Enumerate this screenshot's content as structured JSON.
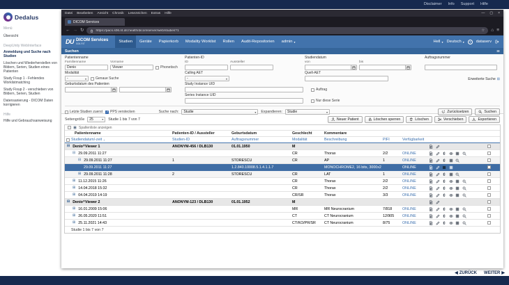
{
  "outer": {
    "top_links": [
      "Disclaimer",
      "Info",
      "Support",
      "Hilfe"
    ],
    "back_label": "ZURÜCK",
    "next_label": "WEITER"
  },
  "sidebar": {
    "brand": "Dedalus",
    "menu_label": "Menü",
    "items": [
      {
        "label": "Übersicht",
        "type": "item"
      },
      {
        "label": "DeepUnity WebInterface",
        "type": "section"
      },
      {
        "label": "Anmeldung und Suche nach Studien",
        "type": "item",
        "active": true
      },
      {
        "label": "Löschen und Wiederherstellen von Bildern, Serien, Studien eines Patienten",
        "type": "item"
      },
      {
        "label": "Study Fixup 1 - Fehlendes Worklistmatching",
        "type": "item"
      },
      {
        "label": "Study Fixup 2 - verschieben von Bildern, Serien, Studien",
        "type": "item"
      },
      {
        "label": "Datensanierung - DICOM Daten korrigieren",
        "type": "item"
      },
      {
        "label": "Hilfe",
        "type": "section"
      },
      {
        "label": "Hilfe und Gebrauchsanweisung",
        "type": "item"
      }
    ]
  },
  "browser": {
    "menubar": [
      "Datei",
      "Bearbeiten",
      "Ansicht",
      "Chronik",
      "Lesezeichen",
      "Extras",
      "Hilfe"
    ],
    "window_controls": [
      "—",
      "▢",
      "×"
    ],
    "tab_title": "DICOM Services",
    "url": "https://pacs.s06.rit.dit.health/dicomserver/web/studies?1"
  },
  "app": {
    "logo_text": "DU",
    "title": "DICOM Services",
    "subtitle": "S06.RIT",
    "nav": [
      {
        "label": "Studien",
        "active": true
      },
      {
        "label": "Geräte"
      },
      {
        "label": "Papierkorb"
      },
      {
        "label": "Modality Worklist"
      },
      {
        "label": "Rollen"
      },
      {
        "label": "Audit-Repositorien"
      },
      {
        "label": "admin",
        "caret": true
      }
    ],
    "theme_label": "Hell",
    "language_label": "Deutsch",
    "user_label": "dataserv"
  },
  "search": {
    "section_title": "Suchen",
    "patient_name_label": "Patientenname",
    "family_label": "Familienname",
    "family_value": "Denio",
    "given_label": "Vorname",
    "given_value": "Viewer",
    "phonetic_label": "Phonetisch",
    "patient_id_label": "Patienten-ID",
    "id_label": "ID",
    "issuer_label": "Aussteller",
    "study_date_label": "Studiendatum",
    "from_label": "von",
    "to_label": "bis",
    "accession_label": "Auftragsnummer",
    "modality_label": "Modalität",
    "modality_value": "-",
    "exact_search_label": "Genaue Suche",
    "calling_aet_label": "Calling AET",
    "calling_aet_value": "-",
    "source_aet_label": "Quell-AET",
    "advanced_link": "Erweiterte Suche",
    "birth_date_label": "Geburtsdatum des Patienten",
    "study_uid_label": "Study Instance UID",
    "series_uid_label": "Series Instance UID",
    "order_label": "Auftrag",
    "only_series_label": "Nur diese Serie",
    "latest_first_label": "Letzte Studien zuerst",
    "pps_hide_label": "PPS verstecken",
    "search_by_label": "Suche nach:",
    "search_by_value": "Studie",
    "expand_label": "Expandieren:",
    "expand_value": "Studie",
    "reset_label": "Zurücksetzen",
    "search_label": "Suchen"
  },
  "results": {
    "page_size_label": "Seitengröße",
    "page_size_value": "25",
    "range_text": "Studie 1 bis 7 von 7",
    "footer_text": "Studie 1 bis 7 von 7",
    "column_toggle_label": "Spaltenliste anzeigen",
    "actions": [
      {
        "label": "Neuer Patient",
        "icon": "person"
      },
      {
        "label": "Löschen sperren",
        "icon": "lock"
      },
      {
        "label": "Löschen",
        "icon": "trash"
      },
      {
        "label": "Verschieben",
        "icon": "scissors"
      },
      {
        "label": "Exportieren",
        "icon": "export"
      }
    ],
    "header_row1": [
      "Patientenname",
      "Patienten-ID / Aussteller",
      "Geburtsdatum",
      "Geschlecht",
      "Kommentare",
      "",
      "",
      "",
      ""
    ],
    "header_row2": [
      "Studiendatum/-zeit",
      "Studien-ID",
      "Auftragsnummer",
      "Modalität",
      "Beschreibung",
      "PIFI",
      "Verfügbarkeit",
      "",
      ""
    ],
    "rows": [
      {
        "type": "patient",
        "level": 0,
        "exp": "open",
        "c": [
          "Denio^Viewer 1",
          "ANONYM-456 / DLB130",
          "01.01.1950",
          "M",
          "",
          "",
          ""
        ],
        "icons": [
          "doc",
          "edit"
        ]
      },
      {
        "type": "study",
        "level": 1,
        "exp": "open",
        "c": [
          "29.09.2011 11:27",
          "",
          "",
          "CR",
          "Thorax",
          "2/2",
          "ONLINE"
        ],
        "icons": [
          "doc",
          "edit",
          "clip",
          "eye",
          "grid",
          "search"
        ]
      },
      {
        "type": "series",
        "level": 2,
        "exp": "open",
        "c": [
          "29.09.2011 11:27",
          "1",
          "STORESCU",
          "CR",
          "AP",
          "1",
          "ONLINE"
        ],
        "icons": [
          "doc",
          "edit",
          "clip",
          "grid",
          "search"
        ]
      },
      {
        "type": "instance",
        "level": 3,
        "exp": "none",
        "selected": true,
        "c": [
          "29.09.2011 11:27",
          "",
          "1.2.840.10008.5.1.4.1.1.7",
          "",
          "MONOCHROME2, 16 bits, 3000x2342",
          "",
          "ONLINE"
        ],
        "icons": [
          "doc",
          "edit",
          "boxdark",
          "grid"
        ]
      },
      {
        "type": "series",
        "level": 2,
        "exp": "closed",
        "c": [
          "29.09.2011 11:28",
          "2",
          "STORESCU",
          "CR",
          "LAT",
          "1",
          "ONLINE"
        ],
        "icons": [
          "doc",
          "edit",
          "clip",
          "grid",
          "search"
        ]
      },
      {
        "type": "study",
        "level": 1,
        "exp": "closed",
        "c": [
          "11.12.2015 11:26",
          "",
          "",
          "CR",
          "Thorax",
          "2/2",
          "ONLINE"
        ],
        "icons": [
          "doc",
          "edit",
          "clip",
          "eye",
          "grid",
          "search"
        ]
      },
      {
        "type": "study",
        "level": 1,
        "exp": "closed",
        "c": [
          "14.04.2018 15:32",
          "",
          "",
          "CR",
          "Thorax",
          "2/2",
          "ONLINE"
        ],
        "icons": [
          "doc",
          "edit",
          "clip",
          "eye",
          "grid",
          "search"
        ]
      },
      {
        "type": "study",
        "level": 1,
        "exp": "closed",
        "c": [
          "04.04.2019 14:19",
          "",
          "",
          "CR/SR",
          "Thorax",
          "3/3",
          "ONLINE"
        ],
        "icons": [
          "doc",
          "edit",
          "clip",
          "eye",
          "grid",
          "search"
        ]
      },
      {
        "type": "patient",
        "level": 0,
        "exp": "open",
        "c": [
          "Denio^Viewer 2",
          "ANONYM-123 / DLB130",
          "01.01.1952",
          "M",
          "",
          "",
          ""
        ],
        "icons": [
          "doc",
          "edit"
        ]
      },
      {
        "type": "study",
        "level": 1,
        "exp": "closed",
        "c": [
          "16.01.2009 15:06",
          "",
          "",
          "MR",
          "MR Neurocranium",
          "7/818",
          "ONLINE"
        ],
        "icons": [
          "doc",
          "edit",
          "clip",
          "eye",
          "grid",
          "search"
        ]
      },
      {
        "type": "study",
        "level": 1,
        "exp": "closed",
        "c": [
          "26.05.2020 11:51",
          "",
          "",
          "CT",
          "CT Neurocranium",
          "12/905",
          "ONLINE"
        ],
        "icons": [
          "doc",
          "edit",
          "clip",
          "eye",
          "grid",
          "search"
        ]
      },
      {
        "type": "study",
        "level": 1,
        "exp": "closed",
        "c": [
          "25.11.2021 14:43",
          "",
          "",
          "CT/KO/PR/SR",
          "CT Neurocranium",
          "8/75",
          "ONLINE"
        ],
        "icons": [
          "doc",
          "edit",
          "clip",
          "eye",
          "grid",
          "search"
        ]
      }
    ]
  }
}
